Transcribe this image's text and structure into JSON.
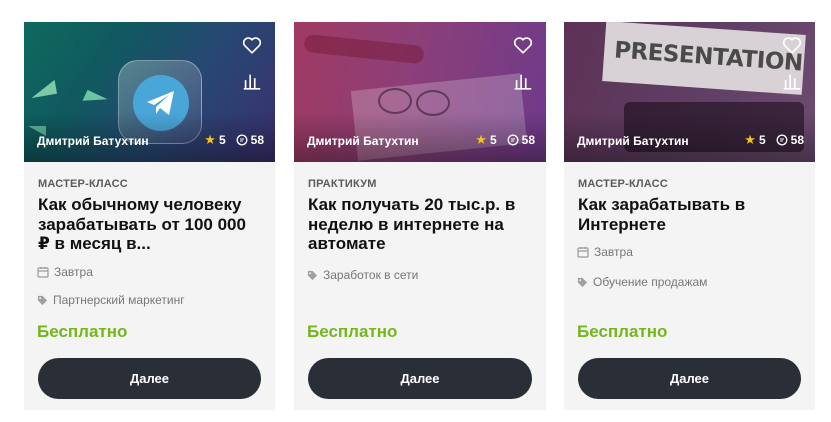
{
  "colors": {
    "price": "#74b61c",
    "button_bg": "#2a2f37",
    "star": "#f6c21a",
    "card_bg": "#f4f4f5"
  },
  "cards": [
    {
      "author": "Дмитрий Батухтин",
      "rating": "5",
      "comments": "58",
      "type": "МАСТЕР-КЛАСС",
      "title": "Как обычному человеку зарабатывать от 100 000 ₽ в месяц в...",
      "date": "Завтра",
      "category": "Партнерский маркетинг",
      "price": "Бесплатно",
      "button": "Далее"
    },
    {
      "author": "Дмитрий Батухтин",
      "rating": "5",
      "comments": "58",
      "type": "ПРАКТИКУМ",
      "title": "Как получать 20 тыс.р. в неделю в интернете на автомате",
      "category": "Заработок в сети",
      "price": "Бесплатно",
      "button": "Далее"
    },
    {
      "author": "Дмитрий Батухтин",
      "rating": "5",
      "comments": "58",
      "type": "МАСТЕР-КЛАСС",
      "title": "Как зарабатывать в Интернете",
      "date": "Завтра",
      "category": "Обучение продажам",
      "price": "Бесплатно",
      "button": "Далее",
      "cover_text": "PRESENTATION"
    }
  ]
}
